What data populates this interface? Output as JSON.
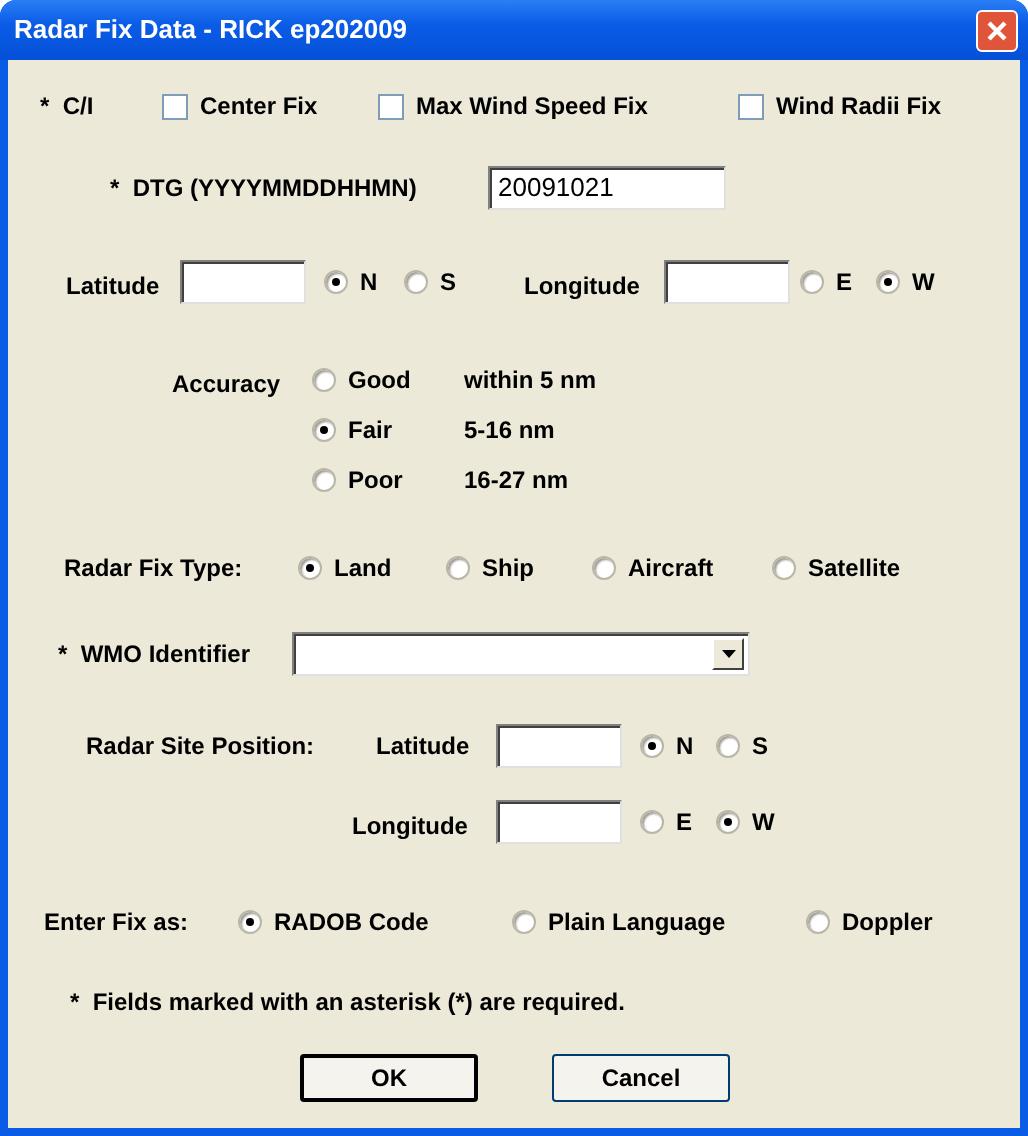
{
  "window": {
    "title": "Radar Fix Data - RICK ep202009"
  },
  "ci": {
    "label": "*  C/I",
    "options": [
      {
        "label": "Center Fix",
        "checked": false
      },
      {
        "label": "Max Wind Speed Fix",
        "checked": false
      },
      {
        "label": "Wind Radii Fix",
        "checked": false
      }
    ]
  },
  "dtg": {
    "label": "*  DTG (YYYYMMDDHHMN)",
    "value": "20091021"
  },
  "position": {
    "latitude": {
      "label": "Latitude",
      "options": [
        {
          "label": "N",
          "selected": true
        },
        {
          "label": "S",
          "selected": false
        }
      ]
    },
    "longitude": {
      "label": "Longitude",
      "options": [
        {
          "label": "E",
          "selected": false
        },
        {
          "label": "W",
          "selected": true
        }
      ]
    }
  },
  "accuracy": {
    "label": "Accuracy",
    "options": [
      {
        "label": "Good",
        "range": "within 5 nm",
        "selected": false
      },
      {
        "label": "Fair",
        "range": "5-16 nm",
        "selected": true
      },
      {
        "label": "Poor",
        "range": "16-27 nm",
        "selected": false
      }
    ]
  },
  "fix_type": {
    "label": "Radar Fix Type:",
    "options": [
      {
        "label": "Land",
        "selected": true
      },
      {
        "label": "Ship",
        "selected": false
      },
      {
        "label": "Aircraft",
        "selected": false
      },
      {
        "label": "Satellite",
        "selected": false
      }
    ]
  },
  "wmo": {
    "label": "*  WMO Identifier"
  },
  "site": {
    "label": "Radar Site Position:",
    "latitude": {
      "label": "Latitude",
      "options": [
        {
          "label": "N",
          "selected": true
        },
        {
          "label": "S",
          "selected": false
        }
      ]
    },
    "longitude": {
      "label": "Longitude",
      "options": [
        {
          "label": "E",
          "selected": false
        },
        {
          "label": "W",
          "selected": true
        }
      ]
    }
  },
  "enter_as": {
    "label": "Enter Fix as:",
    "options": [
      {
        "label": "RADOB Code",
        "selected": true
      },
      {
        "label": "Plain Language",
        "selected": false
      },
      {
        "label": "Doppler",
        "selected": false
      }
    ]
  },
  "note": "*  Fields marked with an asterisk (*) are required.",
  "buttons": [
    {
      "label": "OK",
      "default": true
    },
    {
      "label": "Cancel",
      "default": false
    }
  ]
}
